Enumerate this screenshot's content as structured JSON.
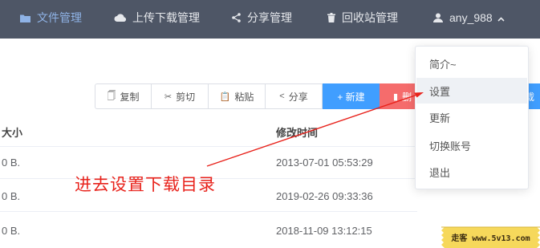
{
  "nav": {
    "items": [
      {
        "label": "文件管理",
        "icon": "folder-icon"
      },
      {
        "label": "上传下载管理",
        "icon": "cloud-icon"
      },
      {
        "label": "分享管理",
        "icon": "share-icon"
      },
      {
        "label": "回收站管理",
        "icon": "trash-icon"
      }
    ],
    "user": {
      "name": "any_988",
      "icon": "user-icon",
      "caret_icon": "chevron-up-icon"
    }
  },
  "toolbar": {
    "copy": "复制",
    "cut": "剪切",
    "paste": "粘贴",
    "share": "分享",
    "new": "+ 新建",
    "delete": "删",
    "edge_label": "载"
  },
  "table": {
    "headers": {
      "size": "大小",
      "modified": "修改时间"
    },
    "rows": [
      {
        "size": "0 B.",
        "modified": "2013-07-01 05:53:29"
      },
      {
        "size": "0 B.",
        "modified": "2019-02-26 09:33:36"
      },
      {
        "size": "0 B.",
        "modified": "2018-11-09 13:12:15"
      }
    ]
  },
  "dropdown": {
    "items": [
      "简介~",
      "设置",
      "更新",
      "切换账号",
      "退出"
    ],
    "highlighted": "设置"
  },
  "annotation": {
    "text": "进去设置下载目录",
    "color": "#e8221b"
  },
  "watermark": {
    "text": "走客 www.5v13.com"
  },
  "colors": {
    "nav_bg": "#4e5666",
    "nav_active": "#8fb3e6",
    "primary": "#409eff",
    "danger": "#f56c6c"
  }
}
